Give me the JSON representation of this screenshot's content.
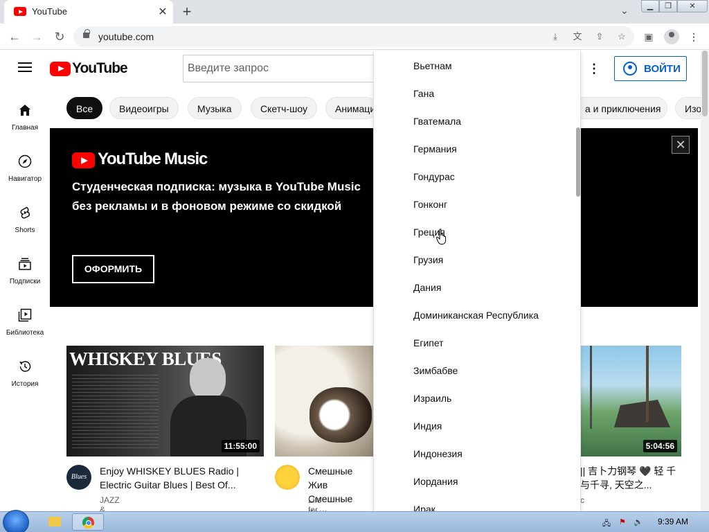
{
  "browser": {
    "tab_title": "YouTube",
    "tab_close": "✕",
    "new_tab": "+",
    "url": "youtube.com",
    "tab_search_icon": "chevron-down-icon"
  },
  "header": {
    "logo_text": "YouTube",
    "search_placeholder": "Введите запрос",
    "signin_label": "ВОЙТИ"
  },
  "chips": [
    "Все",
    "Видеоигры",
    "Музыка",
    "Скетч-шоу",
    "Анимаци",
    "а и приключения",
    "Изо"
  ],
  "sidebar": {
    "items": [
      {
        "label": "Главная",
        "icon": "home-icon"
      },
      {
        "label": "Навигатор",
        "icon": "compass-icon"
      },
      {
        "label": "Shorts",
        "icon": "shorts-icon"
      },
      {
        "label": "Подписки",
        "icon": "subscriptions-icon"
      },
      {
        "label": "Библиотека",
        "icon": "library-icon"
      },
      {
        "label": "История",
        "icon": "history-icon"
      }
    ]
  },
  "banner": {
    "brand": "YouTube Music",
    "text": "Студенческая подписка: музыка в YouTube Music без рекламы и в фоновом режиме со скидкой",
    "button": "ОФОРМИТЬ",
    "close": "✕"
  },
  "videos": [
    {
      "duration": "11:55:00",
      "title": "Enjoy WHISKEY BLUES Radio | Electric Guitar Blues | Best Of...",
      "channel": "JAZZ & BLUES",
      "thumb_text": "WHISKEY BLUES",
      "avatar_text": "Blues"
    },
    {
      "duration": "",
      "title": "Смешные Жив Смешные Кош",
      "channel": "Life for Fun",
      "thumb_text": "",
      "avatar_text": ""
    },
    {
      "duration": "5:04:56",
      "title": "|| 吉卜力钢琴 🖤 轻 千与千寻, 天空之...",
      "channel": "c",
      "thumb_text": "",
      "avatar_text": ""
    }
  ],
  "dropdown": {
    "items": [
      "Вьетнам",
      "Гана",
      "Гватемала",
      "Германия",
      "Гондурас",
      "Гонконг",
      "Греция",
      "Грузия",
      "Дания",
      "Доминиканская Республика",
      "Египет",
      "Зимбабве",
      "Израиль",
      "Индия",
      "Индонезия",
      "Иордания",
      "Ирак"
    ]
  },
  "taskbar": {
    "time": "9:39 AM"
  },
  "colors": {
    "yt_red": "#ff0000",
    "link_blue": "#065fd4",
    "chip_active": "#0f0f0f"
  }
}
